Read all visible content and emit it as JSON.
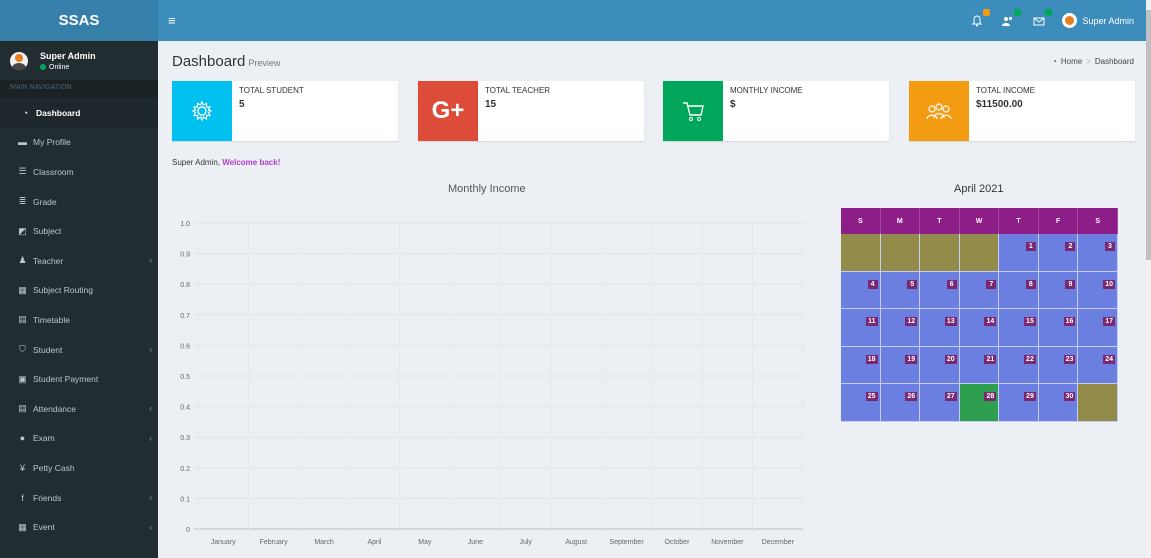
{
  "brand": "SSAS",
  "topbar": {
    "menu_icon": "≡",
    "user": "Super Admin",
    "icons": [
      {
        "name": "bell-icon",
        "glyph": "🔔",
        "badge_color": "#f39c12"
      },
      {
        "name": "users-icon",
        "glyph": "👥",
        "badge_color": "#00a65a"
      },
      {
        "name": "envelope-icon",
        "glyph": "✉",
        "badge_color": "#00a65a"
      }
    ]
  },
  "sidebar": {
    "user_name": "Super Admin",
    "status": "Online",
    "nav_header": "MAIN NAVIGATION",
    "items": [
      {
        "label": "Dashboard",
        "icon": "dashboard-icon",
        "glyph": "◔",
        "active": true,
        "chevron": false
      },
      {
        "label": "My Profile",
        "icon": "profile-icon",
        "glyph": "▬",
        "active": false,
        "chevron": false
      },
      {
        "label": "Classroom",
        "icon": "list-icon",
        "glyph": "☰",
        "active": false,
        "chevron": false
      },
      {
        "label": "Grade",
        "icon": "database-icon",
        "glyph": "≣",
        "active": false,
        "chevron": false
      },
      {
        "label": "Subject",
        "icon": "book-icon",
        "glyph": "◩",
        "active": false,
        "chevron": false
      },
      {
        "label": "Teacher",
        "icon": "user-icon",
        "glyph": "♟",
        "active": false,
        "chevron": true
      },
      {
        "label": "Subject Routing",
        "icon": "grid-icon",
        "glyph": "▦",
        "active": false,
        "chevron": false
      },
      {
        "label": "Timetable",
        "icon": "calendar-icon",
        "glyph": "▤",
        "active": false,
        "chevron": false
      },
      {
        "label": "Student",
        "icon": "graduation-icon",
        "glyph": "⛉",
        "active": false,
        "chevron": true
      },
      {
        "label": "Student Payment",
        "icon": "money-icon",
        "glyph": "▣",
        "active": false,
        "chevron": false
      },
      {
        "label": "Attendance",
        "icon": "calendar-check-icon",
        "glyph": "▤",
        "active": false,
        "chevron": true
      },
      {
        "label": "Exam",
        "icon": "circle-icon",
        "glyph": "●",
        "active": false,
        "chevron": true
      },
      {
        "label": "Petty Cash",
        "icon": "yen-icon",
        "glyph": "¥",
        "active": false,
        "chevron": false
      },
      {
        "label": "Friends",
        "icon": "facebook-icon",
        "glyph": "f",
        "active": false,
        "chevron": true
      },
      {
        "label": "Event",
        "icon": "event-icon",
        "glyph": "▦",
        "active": false,
        "chevron": true
      }
    ]
  },
  "page": {
    "title": "Dashboard",
    "subtitle": "Preview",
    "breadcrumb_home": "Home",
    "breadcrumb_current": "Dashboard"
  },
  "info_boxes": [
    {
      "label": "TOTAL STUDENT",
      "value": "5",
      "color": "#00c0ef",
      "icon": "gear-icon"
    },
    {
      "label": "TOTAL TEACHER",
      "value": "15",
      "color": "#dd4b39",
      "icon": "google-plus-icon"
    },
    {
      "label": "MONTHLY INCOME",
      "value": "$",
      "color": "#00a65a",
      "icon": "cart-icon"
    },
    {
      "label": "TOTAL INCOME",
      "value": "$11500.00",
      "color": "#f39c12",
      "icon": "group-icon"
    }
  ],
  "welcome": {
    "name": "Super Admin,",
    "message": "Welcome back!"
  },
  "chart_data": {
    "type": "line",
    "title": "Monthly Income",
    "categories": [
      "January",
      "February",
      "March",
      "April",
      "May",
      "June",
      "July",
      "August",
      "September",
      "October",
      "November",
      "December"
    ],
    "y_ticks": [
      "1.0",
      "0.9",
      "0.8",
      "0.7",
      "0.6",
      "0.5",
      "0.4",
      "0.3",
      "0.2",
      "0.1",
      "0"
    ],
    "ylim": [
      0,
      1
    ],
    "series": [],
    "grid": true
  },
  "calendar": {
    "title": "April 2021",
    "days": [
      "S",
      "M",
      "T",
      "W",
      "T",
      "F",
      "S"
    ],
    "leading_blanks": 4,
    "trailing_blanks": 1,
    "num_days": 30,
    "today": 28
  }
}
